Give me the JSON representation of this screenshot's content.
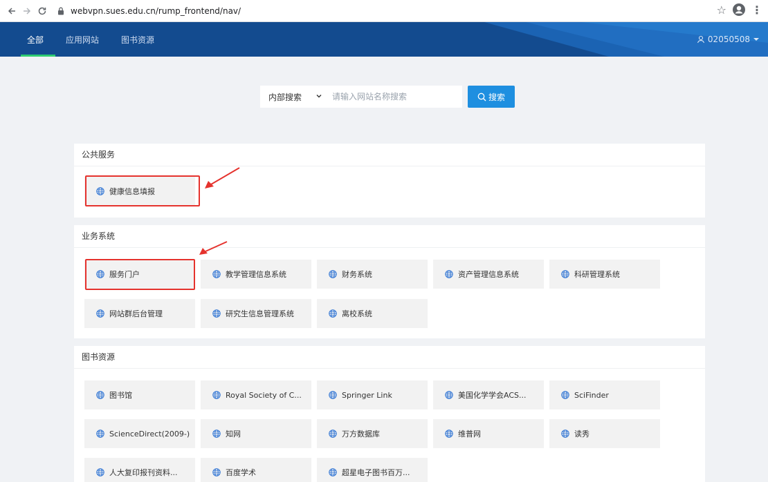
{
  "browser": {
    "url": "webvpn.sues.edu.cn/rump_frontend/nav/",
    "icons": [
      "back-icon",
      "forward-icon",
      "reload-icon",
      "lock-icon",
      "star-icon",
      "profile-icon",
      "kebab-menu-icon"
    ]
  },
  "header": {
    "tabs": [
      {
        "label": "全部",
        "active": true
      },
      {
        "label": "应用网站",
        "active": false
      },
      {
        "label": "图书资源",
        "active": false
      }
    ],
    "user": "02050508",
    "colors": {
      "bar": "#134b8f",
      "active_underline": "#2ecc71"
    }
  },
  "search": {
    "scope": "内部搜索",
    "placeholder": "请输入网站名称搜索",
    "button": "搜索"
  },
  "sections": [
    {
      "title": "公共服务",
      "items": [
        "健康信息填报"
      ]
    },
    {
      "title": "业务系统",
      "items": [
        "服务门户",
        "教学管理信息系统",
        "财务系统",
        "资产管理信息系统",
        "科研管理系统",
        "网站群后台管理",
        "研究生信息管理系统",
        "离校系统"
      ]
    },
    {
      "title": "图书资源",
      "items": [
        "图书馆",
        "Royal Society of C...",
        "Springer Link",
        "美国化学学会ACS...",
        "SciFinder",
        "ScienceDirect(2009-)",
        "知网",
        "万方数据库",
        "维普网",
        "读秀",
        "人大复印报刊资料...",
        "百度学术",
        "超星电子图书百万..."
      ]
    }
  ],
  "annotations": {
    "highlighted_items": [
      "健康信息填报",
      "服务门户"
    ],
    "color": "#e5322d"
  }
}
